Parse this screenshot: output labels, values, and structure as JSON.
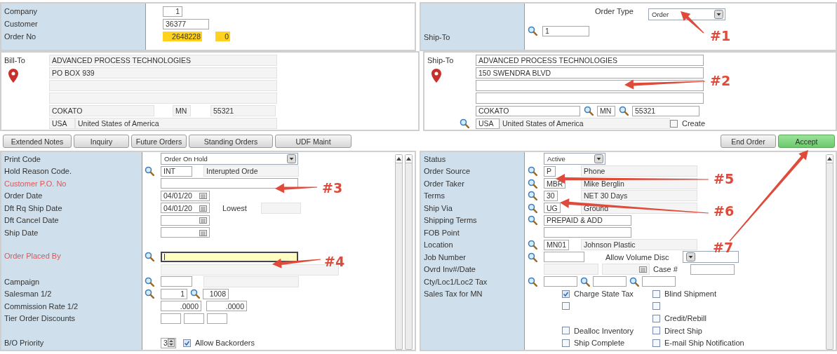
{
  "header": {
    "company_label": "Company",
    "company": "1",
    "customer_label": "Customer",
    "customer": "36377",
    "order_no_label": "Order No",
    "order_no": "2648228",
    "order_suffix": "0"
  },
  "order_type": {
    "label": "Order Type",
    "value": "Order"
  },
  "ship_to_select": {
    "label": "Ship-To",
    "value": "1"
  },
  "bill_to": {
    "label": "Bill-To",
    "lines": [
      "ADVANCED PROCESS TECHNOLOGIES",
      "PO BOX 939"
    ],
    "city": "COKATO",
    "state": "MN",
    "zip": "55321",
    "country_code": "USA",
    "country": "United States of America"
  },
  "ship_to": {
    "label": "Ship-To",
    "lines": [
      "ADVANCED PROCESS TECHNOLOGIES",
      "150 SWENDRA BLVD"
    ],
    "city": "COKATO",
    "state": "MN",
    "zip": "55321",
    "country_code": "USA",
    "country": "United States of America",
    "create": {
      "label": "Create",
      "checked": false
    }
  },
  "toolbar": {
    "left": [
      "Extended Notes",
      "Inquiry",
      "Future Orders",
      "Standing Orders",
      "UDF Maint"
    ],
    "right": [
      {
        "label": "End Order",
        "kind": "normal"
      },
      {
        "label": "Accept",
        "kind": "primary"
      }
    ]
  },
  "left_form": {
    "groups": [
      [
        {
          "label": "Print Code",
          "required": false,
          "kind": "select",
          "value": "Order On Hold"
        },
        {
          "label": "Hold Reason Code.",
          "required": false,
          "kind": "lookup",
          "code": "INT",
          "desc": "Interupted Orde"
        },
        {
          "label": "Customer P.O. No",
          "required": true,
          "kind": "text"
        },
        {
          "label": "Order Date",
          "required": false,
          "kind": "date",
          "value": "04/01/20"
        },
        {
          "label": "Dft Rq Ship Date",
          "required": false,
          "kind": "date",
          "value": "04/01/20",
          "extra_label": "Lowest"
        },
        {
          "label": "Dft Cancel Date",
          "required": false,
          "kind": "date"
        },
        {
          "label": "Ship Date",
          "required": false,
          "kind": "date"
        }
      ],
      [
        {
          "label": "Order Placed By",
          "required": true,
          "kind": "focused_lookup"
        },
        {
          "label": "Campaign",
          "required": false,
          "kind": "lookup"
        },
        {
          "label": "Salesman 1/2",
          "required": false,
          "kind": "lookup_pair",
          "values": [
            "1",
            "1008"
          ]
        },
        {
          "label": "Commission Rate 1/2",
          "required": false,
          "kind": "pair",
          "values": [
            ".0000",
            ".0000"
          ]
        },
        {
          "label": "Tier Order Discounts",
          "required": false,
          "kind": "triple"
        }
      ],
      [
        {
          "label": "B/O Priority",
          "required": false,
          "kind": "priority",
          "value": "3",
          "option": {
            "label": "Allow Backorders",
            "checked": true
          }
        }
      ]
    ]
  },
  "right_form": {
    "rows": [
      {
        "label": "Status",
        "required": false,
        "kind": "select",
        "value": "Active"
      },
      {
        "label": "Order Source",
        "required": false,
        "kind": "lookup",
        "code": "P",
        "desc": "Phone"
      },
      {
        "label": "Order Taker",
        "required": false,
        "kind": "lookup",
        "code": "MBR",
        "desc": "Mike Berglin"
      },
      {
        "label": "Terms",
        "required": false,
        "kind": "lookup",
        "code": "30",
        "desc": "NET 30 Days"
      },
      {
        "label": "Ship Via",
        "required": false,
        "kind": "lookup",
        "code": "UG",
        "desc": "Ground"
      },
      {
        "label": "Shipping Terms",
        "required": false,
        "kind": "lookup_wide",
        "value": "PREPAID & ADD"
      },
      {
        "label": "FOB Point",
        "required": false,
        "kind": "text_wide"
      },
      {
        "label": "Location",
        "required": false,
        "kind": "lookup",
        "code": "MN01",
        "desc": "Johnson Plastic"
      },
      {
        "label": "Job Number",
        "required": false,
        "kind": "job",
        "extra_label": "Allow Volume Disc"
      },
      {
        "label": "Ovrd Inv#/Date",
        "required": false,
        "kind": "override",
        "extra_label": "Case #"
      },
      {
        "label": "Cty/Loc1/Loc2 Tax",
        "required": false,
        "kind": "lookup_triple"
      }
    ],
    "tax": {
      "label": "Sales Tax for MN",
      "option_rows": [
        [
          {
            "label": "Charge State Tax",
            "checked": true
          },
          {
            "label": "Blind Shipment",
            "checked": false
          }
        ],
        [
          {
            "checked": false
          },
          {
            "checked": false
          }
        ],
        [
          null,
          {
            "label": "Credit/Rebill",
            "checked": false
          }
        ],
        [
          {
            "label": "Dealloc Inventory",
            "checked": false
          },
          {
            "label": "Direct Ship",
            "checked": false
          }
        ],
        [
          {
            "label": "Ship Complete",
            "checked": false
          },
          {
            "label": "E-mail Ship Notification",
            "checked": false
          }
        ]
      ]
    }
  },
  "callouts": [
    {
      "label": "#1"
    },
    {
      "label": "#2"
    },
    {
      "label": "#3"
    },
    {
      "label": "#4"
    },
    {
      "label": "#5"
    },
    {
      "label": "#6"
    },
    {
      "label": "#7"
    }
  ]
}
